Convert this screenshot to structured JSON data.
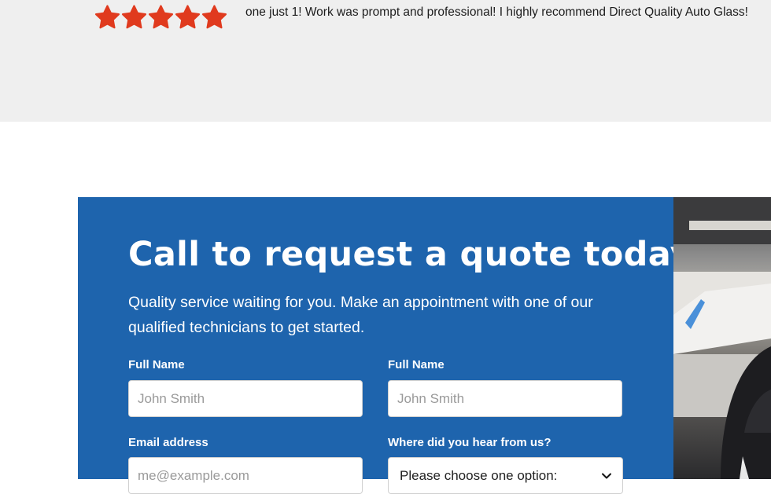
{
  "review": {
    "rating": 5,
    "rating_max": 5,
    "star_color": "#e03a1e",
    "text": "one just 1! Work was prompt and professional! I highly recommend Direct Quality Auto Glass!"
  },
  "quote": {
    "heading": "Call to request a quote today!",
    "subtext": "Quality service waiting for you. Make an appointment with one of our qualified technicians to get started.",
    "panel_color": "#1e64ad",
    "fields": {
      "name_1": {
        "label": "Full Name",
        "placeholder": "John Smith"
      },
      "name_2": {
        "label": "Full Name",
        "placeholder": "John Smith"
      },
      "email": {
        "label": "Email address",
        "placeholder": "me@example.com"
      },
      "source": {
        "label": "Where did you hear from us?",
        "selected": "Please choose one option:",
        "icon": "chevron-down-icon"
      }
    }
  }
}
